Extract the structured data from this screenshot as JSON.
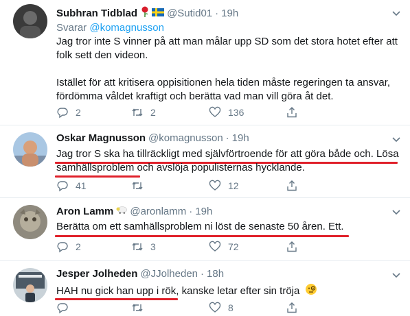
{
  "tweets": [
    {
      "name": "Subhran Tidblad",
      "handle": "@Sutid01",
      "dot": "·",
      "time": "19h",
      "replying_prefix": "Svarar",
      "replying_to": "@komagnusson",
      "text1": "Jag tror inte S vinner på att man målar upp SD som det stora hotet efter att folk sett den videon.",
      "text2": "Istället för att kritisera oppisitionen hela tiden måste regeringen ta ansvar, fördömma våldet kraftigt och berätta vad man vill göra åt det.",
      "replies": "2",
      "retweets": "2",
      "likes": "136"
    },
    {
      "name": "Oskar Magnusson",
      "handle": "@komagnusson",
      "dot": "·",
      "time": "19h",
      "text_line1": "Jag tror S ska ha tillräckligt med självförtroende för att göra både och. Lösa",
      "text_line2_a": "samhällsproblem",
      "text_line2_b": " och avslöja populisternas hycklande.",
      "replies": "41",
      "retweets": "",
      "likes": "12"
    },
    {
      "name": "Aron Lamm",
      "handle": "@aronlamm",
      "dot": "·",
      "time": "19h",
      "text": "Berätta om ett samhällsproblem ni löst de senaste 50 åren. Ett.",
      "replies": "2",
      "retweets": "3",
      "likes": "72"
    },
    {
      "name": "Jesper Jolheden",
      "handle": "@JJolheden",
      "dot": "·",
      "time": "18h",
      "text_a": "HAH nu gick han upp i rök",
      "text_b": ", kanske letar efter sin tröja",
      "replies": "",
      "retweets": "",
      "likes": "8"
    }
  ],
  "colors": {
    "text": "#14171a",
    "muted": "#657786",
    "link": "#1da1f2",
    "underline": "#e0202a",
    "divider": "#e6ecf0"
  },
  "icons": [
    "reply-icon",
    "retweet-icon",
    "like-icon",
    "share-icon",
    "caret-down-icon",
    "rose-emoji-icon",
    "sweden-flag-icon",
    "sheep-emoji-icon",
    "monocle-face-emoji-icon"
  ]
}
